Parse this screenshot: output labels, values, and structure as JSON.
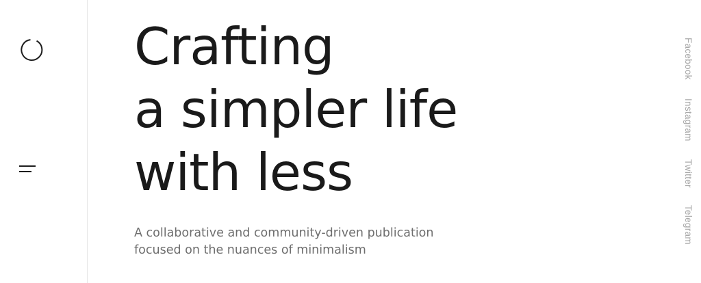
{
  "sidebar": {
    "logo_icon": "circle-logo-icon",
    "menu_icon": "hamburger-menu-icon"
  },
  "hero": {
    "headline_lines": [
      "Crafting",
      "a simpler life",
      "with less"
    ],
    "subtitle_lines": [
      "A collaborative and community-driven publication",
      "focused on the nuances of minimalism"
    ]
  },
  "social": {
    "links": [
      "Facebook",
      "Instagram",
      "Twitter",
      "Telegram"
    ]
  },
  "colors": {
    "text": "#1a1a1a",
    "muted": "#6e6e6e",
    "social": "#a9a9a9",
    "divider": "#e6e6e6"
  }
}
